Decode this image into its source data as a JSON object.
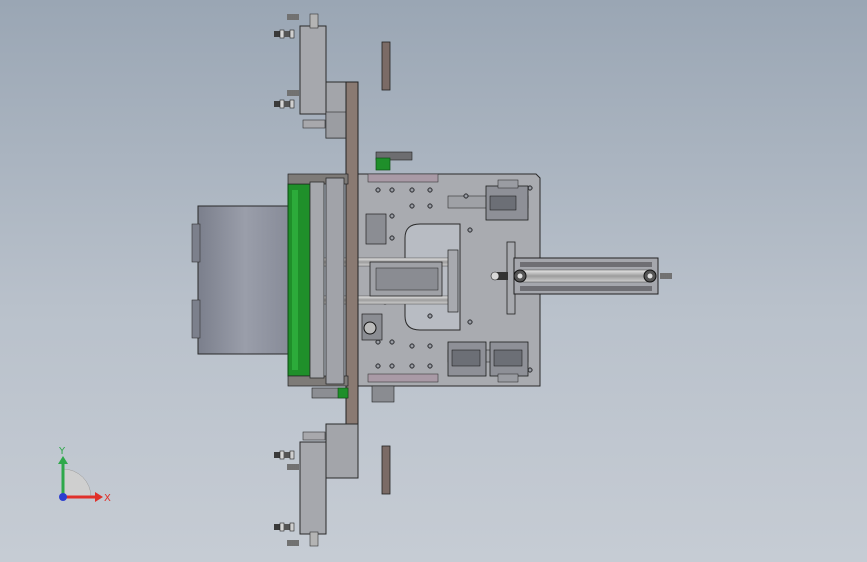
{
  "viewport": {
    "background_top": "#9aa6b4",
    "background_bottom": "#c6ccd4"
  },
  "triad": {
    "x_label": "X",
    "y_label": "Y",
    "x_color": "#e0302a",
    "y_color": "#2ea84a",
    "z_color": "#2c3fcf"
  },
  "colors": {
    "plate": "#a7a9ad",
    "plate_dark": "#8d9096",
    "outline": "#2a2a2a",
    "motor": "#8a8f9c",
    "green_part": "#1f8f2a",
    "brown_bar": "#8a7a72",
    "rail_purple": "#a99aa6"
  }
}
